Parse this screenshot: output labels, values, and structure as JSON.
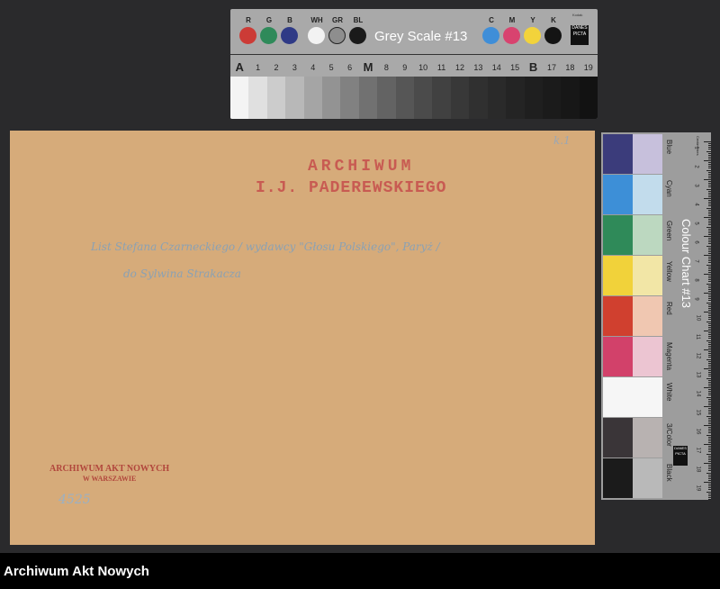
{
  "grey_scale_card": {
    "title": "Grey Scale #13",
    "fine_print": "Kodak",
    "logo_text": "DANES PICTA",
    "patches": [
      {
        "label": "R",
        "color": "#cc3b36"
      },
      {
        "label": "G",
        "color": "#2f8a5a"
      },
      {
        "label": "B",
        "color": "#2f3a86"
      },
      {
        "label": "WH",
        "color": "#f2f2f2"
      },
      {
        "label": "GR",
        "color": "#8e8e8e"
      },
      {
        "label": "BL",
        "color": "#1a1a1a"
      }
    ],
    "cmyk_patches": [
      {
        "label": "C",
        "color": "#3f8ed8"
      },
      {
        "label": "M",
        "color": "#d8436f"
      },
      {
        "label": "Y",
        "color": "#f2d33b"
      },
      {
        "label": "K",
        "color": "#141414"
      }
    ],
    "scale_numbers": [
      "A",
      "1",
      "2",
      "3",
      "4",
      "5",
      "6",
      "M",
      "8",
      "9",
      "10",
      "11",
      "12",
      "13",
      "14",
      "15",
      "B",
      "17",
      "18",
      "19"
    ],
    "steps": [
      "#f4f4f4",
      "#e0e0e0",
      "#cccccc",
      "#b8b8b8",
      "#a5a5a5",
      "#939393",
      "#818181",
      "#717171",
      "#636363",
      "#565656",
      "#4b4b4b",
      "#414141",
      "#383838",
      "#303030",
      "#2a2a2a",
      "#242424",
      "#1f1f1f",
      "#1b1b1b",
      "#171717",
      "#121212"
    ]
  },
  "envelope": {
    "stamp_top_line1": "ARCHIWUM",
    "stamp_top_line2": "I.J. PADEREWSKIEGO",
    "handwriting_line1": "List Stefana Czarneckiego / wydawcy \"Głosu Polskiego\", Paryż /",
    "handwriting_line2": "do Sylwina Strakacza",
    "corner_mark": "k.1",
    "stamp_bottom_line1": "ARCHIWUM AKT NOWYCH",
    "stamp_bottom_line2": "W WARSZAWIE",
    "signature_number": "4525"
  },
  "colour_chart": {
    "title": "Colour Chart #13",
    "unit": "Centimetres",
    "logo_text": "DANES PICTA",
    "rows": [
      {
        "name": "Blue",
        "dark": "#3b3c7b",
        "light": "#c7c0dc"
      },
      {
        "name": "Cyan",
        "dark": "#3d8fd7",
        "light": "#c2dcec"
      },
      {
        "name": "Green",
        "dark": "#2f8a59",
        "light": "#bcd8c0"
      },
      {
        "name": "Yellow",
        "dark": "#f1d23a",
        "light": "#f2e6a6"
      },
      {
        "name": "Red",
        "dark": "#d0402f",
        "light": "#f0c7b1"
      },
      {
        "name": "Magenta",
        "dark": "#d2416a",
        "light": "#ecc5d2"
      },
      {
        "name": "White",
        "dark": "#f6f6f6",
        "light": "#f6f6f6"
      },
      {
        "name": "3/Color",
        "dark": "#3a3538",
        "light": "#b8b2b1"
      },
      {
        "name": "Black",
        "dark": "#1b1b1b",
        "light": "#b9b9b9"
      }
    ],
    "ruler_numbers": [
      "1",
      "2",
      "3",
      "4",
      "5",
      "6",
      "7",
      "8",
      "9",
      "10",
      "11",
      "12",
      "13",
      "14",
      "15",
      "16",
      "17",
      "18",
      "19"
    ]
  },
  "footer": {
    "label": "Archiwum Akt Nowych"
  }
}
